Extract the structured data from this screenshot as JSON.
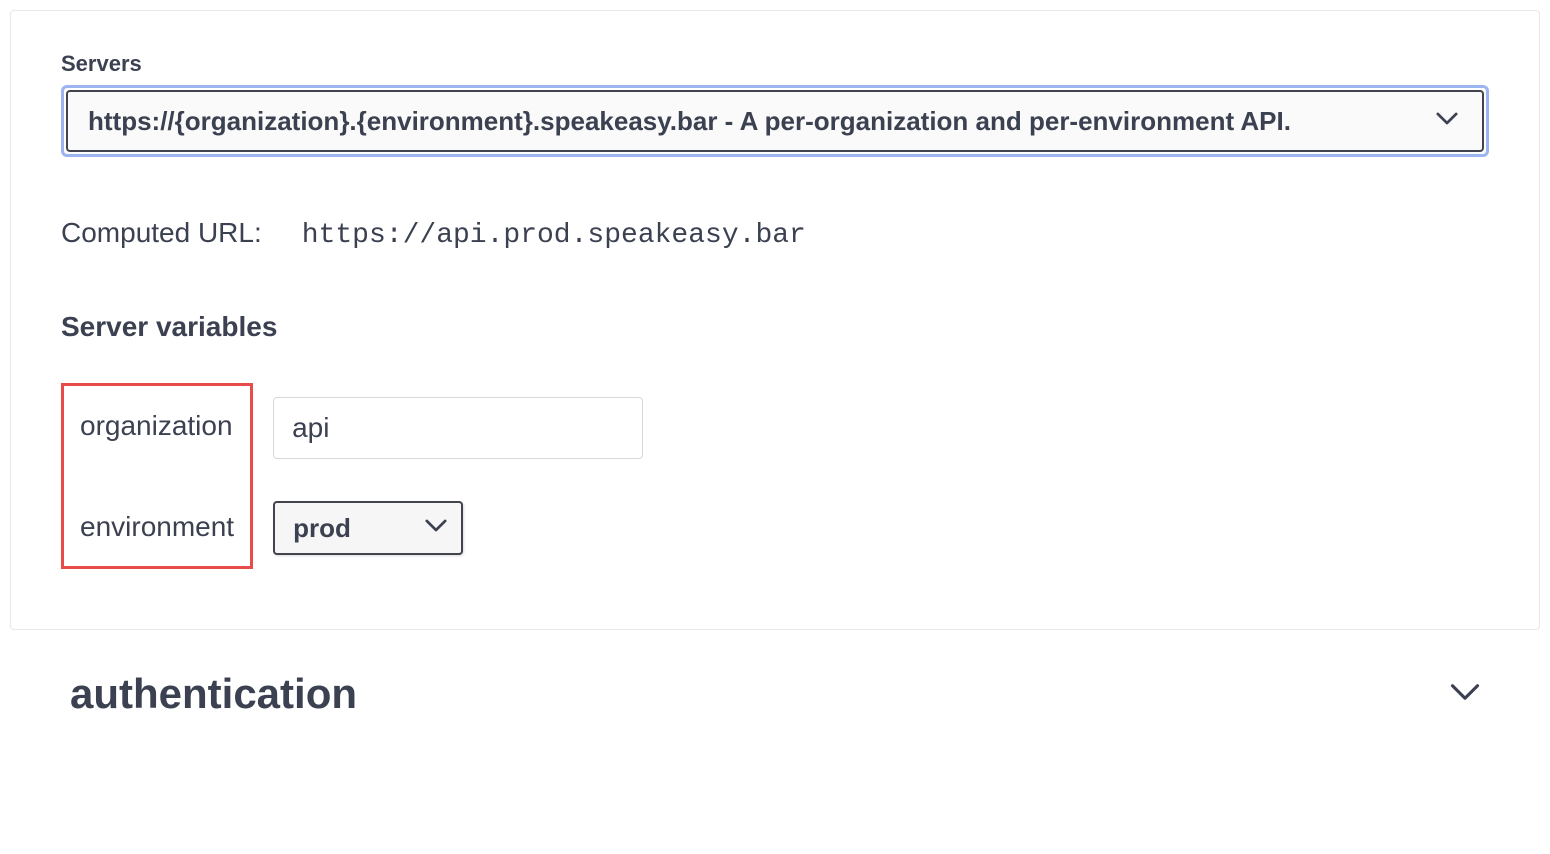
{
  "servers": {
    "label": "Servers",
    "selected": "https://{organization}.{environment}.speakeasy.bar - A per-organization and per-environment API."
  },
  "computed_url": {
    "label": "Computed URL:",
    "value": "https://api.prod.speakeasy.bar"
  },
  "server_variables": {
    "label": "Server variables",
    "vars": [
      {
        "name": "organization",
        "value": "api",
        "type": "text"
      },
      {
        "name": "environment",
        "value": "prod",
        "type": "select"
      }
    ]
  },
  "sections": {
    "authentication": {
      "title": "authentication"
    }
  }
}
